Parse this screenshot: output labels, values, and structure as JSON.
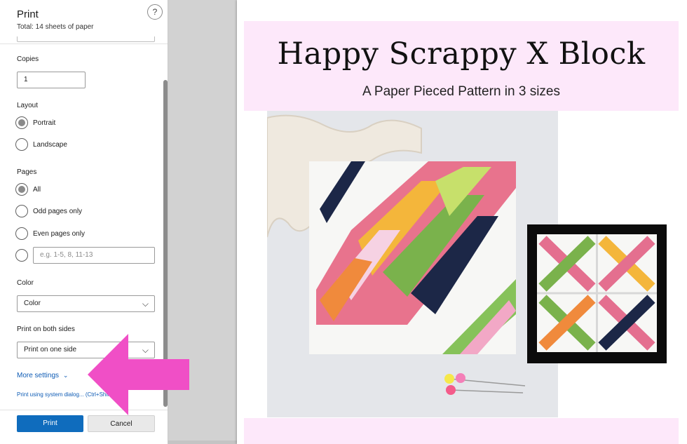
{
  "dialog": {
    "title": "Print",
    "subtitle": "Total: 14 sheets of paper",
    "help_glyph": "?",
    "copies": {
      "label": "Copies",
      "value": "1"
    },
    "layout": {
      "label": "Layout",
      "options": [
        {
          "label": "Portrait",
          "selected": true
        },
        {
          "label": "Landscape",
          "selected": false
        }
      ]
    },
    "pages": {
      "label": "Pages",
      "options": [
        {
          "label": "All",
          "selected": true
        },
        {
          "label": "Odd pages only",
          "selected": false
        },
        {
          "label": "Even pages only",
          "selected": false
        }
      ],
      "custom_placeholder": "e.g. 1-5, 8, 11-13"
    },
    "color": {
      "label": "Color",
      "value": "Color"
    },
    "duplex": {
      "label": "Print on both sides",
      "value": "Print on one side"
    },
    "more_settings": "More settings",
    "more_settings_chevron": "⌄",
    "system_dialog": "Print using system dialog... (Ctrl+Shift+P)",
    "print_button": "Print",
    "cancel_button": "Cancel",
    "accent_color": "#0f6cbd",
    "arrow_color": "#f04fc6"
  },
  "preview": {
    "title": "Happy Scrappy X Block",
    "subtitle": "A Paper Pieced Pattern in 3 sizes",
    "band_color": "#fde8fa"
  }
}
